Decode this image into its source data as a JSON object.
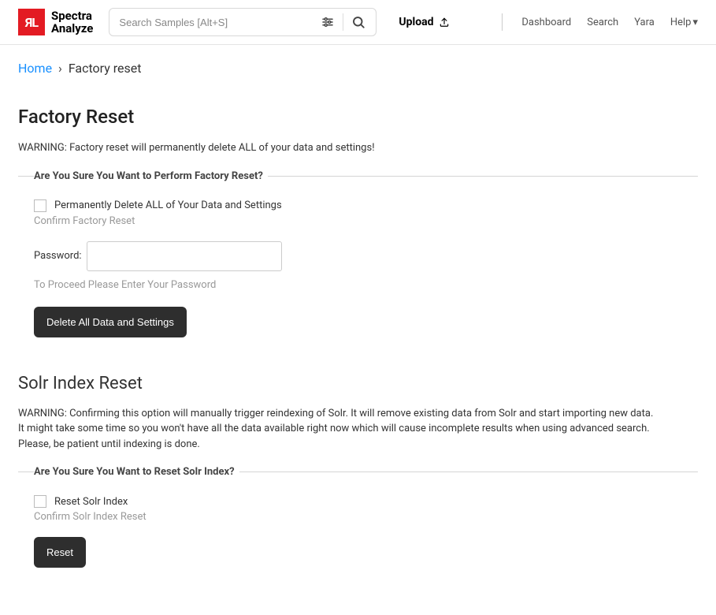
{
  "brand": {
    "logo_mark": "ЯL",
    "name_line1": "Spectra",
    "name_line2": "Analyze"
  },
  "header": {
    "search_placeholder": "Search Samples [Alt+S]",
    "upload_label": "Upload",
    "nav": {
      "dashboard": "Dashboard",
      "search": "Search",
      "yara": "Yara",
      "help": "Help"
    }
  },
  "breadcrumb": {
    "home": "Home",
    "sep": "›",
    "current": "Factory reset"
  },
  "factory": {
    "title": "Factory Reset",
    "warning": "WARNING: Factory reset will permanently delete ALL of your data and settings!",
    "legend": "Are You Sure You Want to Perform Factory Reset?",
    "checkbox_label": "Permanently Delete ALL of Your Data and Settings",
    "confirm_helper": "Confirm Factory Reset",
    "password_label": "Password:",
    "password_helper": "To Proceed Please Enter Your Password",
    "button": "Delete All Data and Settings"
  },
  "solr": {
    "title": "Solr Index Reset",
    "warning_l1": "WARNING: Confirming this option will manually trigger reindexing of Solr. It will remove existing data from Solr and start importing new data.",
    "warning_l2": "It might take some time so you won't have all the data available right now which will cause incomplete results when using advanced search.",
    "warning_l3": "Please, be patient until indexing is done.",
    "legend": "Are You Sure You Want to Reset Solr Index?",
    "checkbox_label": "Reset Solr Index",
    "confirm_helper": "Confirm Solr Index Reset",
    "button": "Reset"
  }
}
